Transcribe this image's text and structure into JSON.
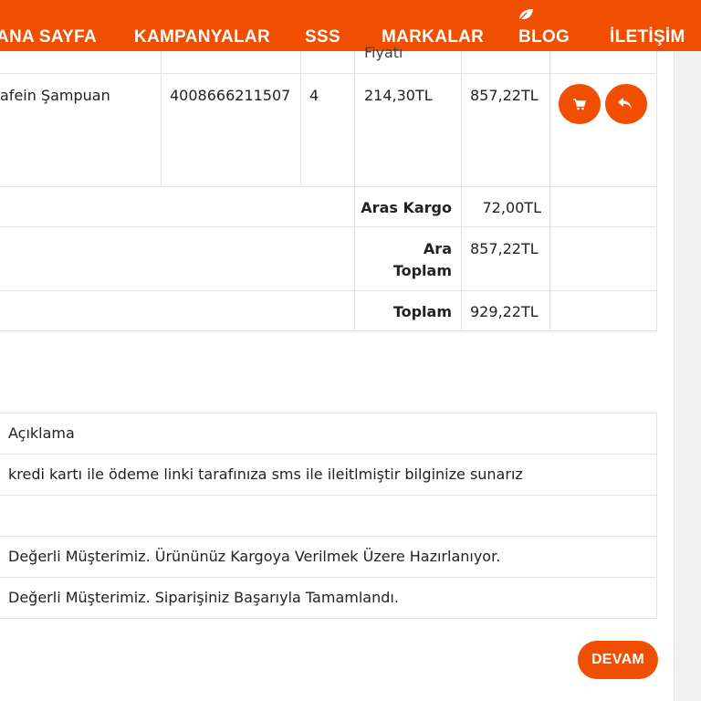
{
  "nav": {
    "items": [
      {
        "label": "ANA SAYFA"
      },
      {
        "label": "KAMPANYALAR"
      },
      {
        "label": "SSS"
      },
      {
        "label": "MARKALAR"
      },
      {
        "label": "BLOG"
      },
      {
        "label": "İLETİŞİM"
      }
    ]
  },
  "order_table": {
    "header_partial": "Fiyatı",
    "row": {
      "product": "afein Şampuan",
      "barcode": "4008666211507",
      "quantity": "4",
      "unit_price": "214,30TL",
      "total": "857,22TL"
    },
    "summary": {
      "shipping_label": "Aras Kargo",
      "shipping_value": "72,00TL",
      "subtotal_label_line1": "Ara",
      "subtotal_label_line2": "Toplam",
      "subtotal_value": "857,22TL",
      "grand_label": "Toplam",
      "grand_value": "929,22TL"
    }
  },
  "notes": {
    "header": "Açıklama",
    "rows": [
      "kredi kartı ile ödeme linki tarafınıza sms ile ileitlmiştir bilginize sunarız",
      "",
      "Değerli Müşterimiz. Ürününüz Kargoya Verilmek Üzere Hazırlanıyor.",
      "Değerli Müşterimiz. Siparişiniz Başarıyla Tamamlandı."
    ]
  },
  "actions": {
    "devam_label": "DEVAM"
  },
  "icons": {
    "cart": "cart-icon",
    "return": "reply-icon",
    "blog": "leaf-icon"
  },
  "colors": {
    "accent": "#f04e00",
    "border": "#e3e3e3"
  }
}
